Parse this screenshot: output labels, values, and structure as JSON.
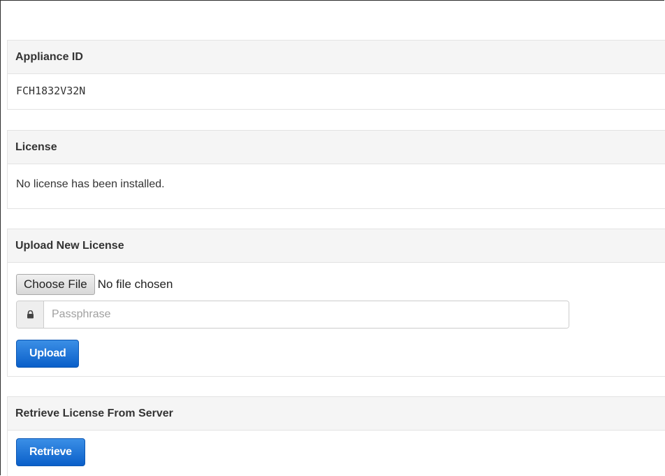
{
  "appliance": {
    "heading": "Appliance ID",
    "value": "FCH1832V32N"
  },
  "license": {
    "heading": "License",
    "status_text": "No license has been installed."
  },
  "upload": {
    "heading": "Upload New License",
    "choose_file_label": "Choose File",
    "file_status": "No file chosen",
    "passphrase_placeholder": "Passphrase",
    "passphrase_value": "",
    "lock_icon": "lock-icon",
    "upload_label": "Upload"
  },
  "retrieve": {
    "heading": "Retrieve License From Server",
    "retrieve_label": "Retrieve"
  },
  "colors": {
    "primary": "#0a5fc9",
    "panel_heading_bg": "#f5f5f5",
    "border": "#e3e3e3"
  }
}
